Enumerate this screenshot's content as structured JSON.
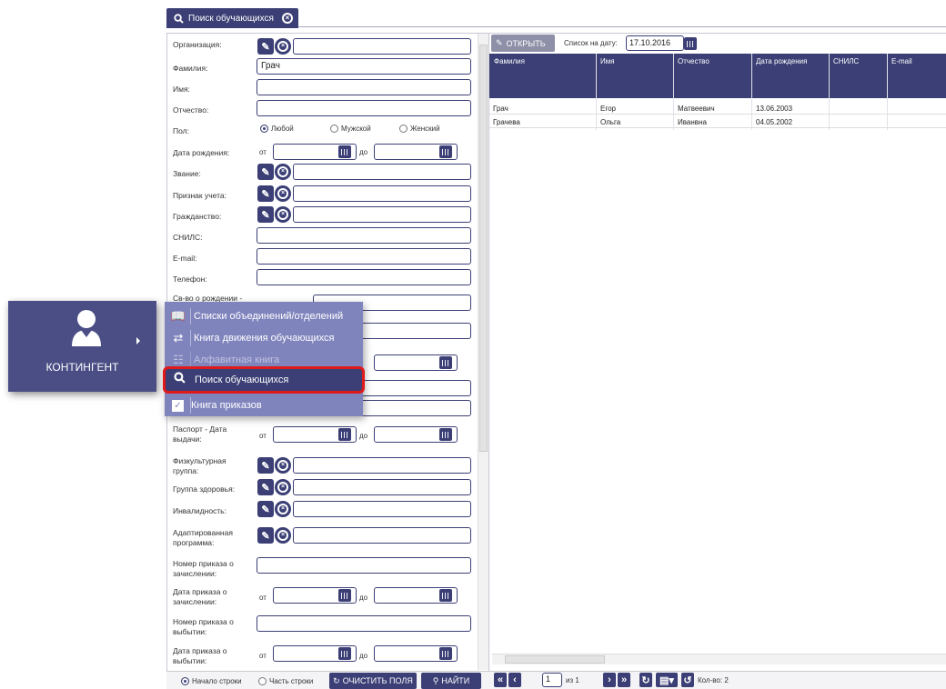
{
  "tab": {
    "title": "Поиск обучающихся"
  },
  "form": {
    "organization": "Организация:",
    "surname": "Фамилия:",
    "surname_value": "Грач",
    "name": "Имя:",
    "patronymic": "Отчество:",
    "gender": "Пол:",
    "gender_any": "Любой",
    "gender_male": "Мужской",
    "gender_female": "Женский",
    "birth_date": "Дата рождения:",
    "from": "от",
    "to": "до",
    "rank": "Звание:",
    "account_sign": "Признак учета:",
    "citizenship": "Гражданство:",
    "snils": "СНИЛС:",
    "email": "E-mail:",
    "phone": "Телефон:",
    "birth_cert": "Св-во о рождении -",
    "passport_date_1": "Паспорт - Дата",
    "passport_date_2": "выдачи:",
    "phys_group_1": "Физкультурная",
    "phys_group_2": "группа:",
    "health_group": "Группа здоровья:",
    "disability": "Инвалидность:",
    "adapted_1": "Адаптированная",
    "adapted_2": "программа:",
    "enroll_no_1": "Номер приказа о",
    "enroll_no_2": "зачислении:",
    "enroll_date_1": "Дата приказа о",
    "enroll_date_2": "зачислении:",
    "leave_no_1": "Номер приказа о",
    "leave_no_2": "выбытии:",
    "leave_date_1": "Дата приказа о",
    "leave_date_2": "выбытии:"
  },
  "right": {
    "open_label": "ОТКРЫТЬ",
    "list_date_label": "Список на дату:",
    "list_date_value": "17.10.2016",
    "columns": [
      "Фамилия",
      "Имя",
      "Отчество",
      "Дата рождения",
      "СНИЛС",
      "E-mail"
    ],
    "rows": [
      [
        "Грач",
        "Егор",
        "Матвеевич",
        "13.06.2003",
        "",
        ""
      ],
      [
        "Грачева",
        "Ольга",
        "Иванвна",
        "04.05.2002",
        "",
        ""
      ]
    ]
  },
  "footer": {
    "start_of_line": "Начало строки",
    "part_of_line": "Часть строки",
    "clear_fields": "ОЧИСТИТЬ ПОЛЯ",
    "find": "НАЙТИ",
    "page": "1",
    "of_pages": "из 1",
    "count": "Кол-во: 2"
  },
  "sidebar": {
    "label": "КОНТИНГЕНТ"
  },
  "menu": {
    "items": [
      {
        "label": "Списки объединений/отделений",
        "icon": "book-icon"
      },
      {
        "label": "Книга движения обучающихся",
        "icon": "transfer-icon"
      },
      {
        "label": "Алфавитная книга",
        "icon": "people-icon"
      },
      {
        "label": "Поиск обучающихся",
        "icon": "search-icon"
      },
      {
        "label": "Книга приказов",
        "icon": "check-icon"
      }
    ]
  },
  "colors": {
    "accent": "#3b3f75",
    "menu_bg": "#8084bd",
    "highlight": "#e01a1a"
  }
}
